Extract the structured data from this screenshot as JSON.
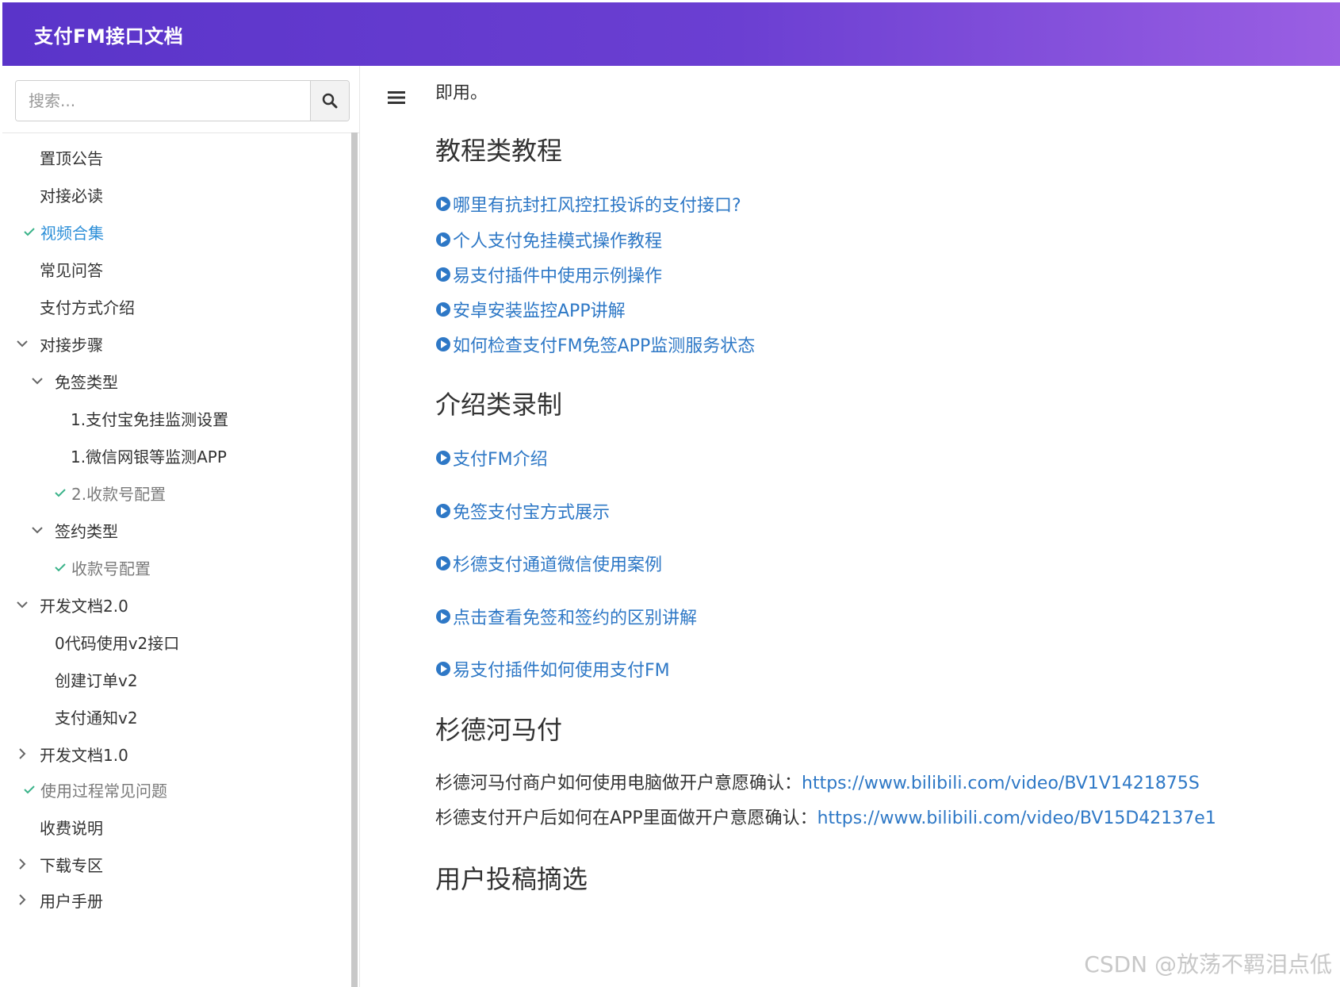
{
  "header": {
    "title": "支付FM接口文档"
  },
  "search": {
    "placeholder": "搜索..."
  },
  "sidebar": {
    "items": [
      {
        "label": "置顶公告"
      },
      {
        "label": "对接必读"
      },
      {
        "label": "视频合集"
      },
      {
        "label": "常见问答"
      },
      {
        "label": "支付方式介绍"
      },
      {
        "label": "对接步骤"
      },
      {
        "label": "免签类型"
      },
      {
        "label": "1.支付宝免挂监测设置"
      },
      {
        "label": "1.微信网银等监测APP"
      },
      {
        "label": "2.收款号配置"
      },
      {
        "label": "签约类型"
      },
      {
        "label": "收款号配置"
      },
      {
        "label": "开发文档2.0"
      },
      {
        "label": "0代码使用v2接口"
      },
      {
        "label": "创建订单v2"
      },
      {
        "label": "支付通知v2"
      },
      {
        "label": "开发文档1.0"
      },
      {
        "label": "使用过程常见问题"
      },
      {
        "label": "收费说明"
      },
      {
        "label": "下载专区"
      },
      {
        "label": "用户手册"
      }
    ]
  },
  "content": {
    "intro_text": "即用。",
    "sections": [
      {
        "heading": "教程类教程",
        "links": [
          "哪里有抗封扛风控扛投诉的支付接口?",
          "个人支付免挂模式操作教程",
          "易支付插件中使用示例操作",
          "安卓安装监控APP讲解",
          "如何检查支付FM免签APP监测服务状态"
        ]
      },
      {
        "heading": "介绍类录制",
        "links": [
          "支付FM介绍",
          "免签支付宝方式展示",
          "杉德支付通道微信使用案例",
          "点击查看免签和签约的区别讲解",
          "易支付插件如何使用支付FM"
        ]
      },
      {
        "heading": "杉德河马付",
        "lines": [
          {
            "text": "杉德河马付商户如何使用电脑做开户意愿确认：",
            "url": "https://www.bilibili.com/video/BV1V1421875S"
          },
          {
            "text": "杉德支付开户后如何在APP里面做开户意愿确认：",
            "url": "https://www.bilibili.com/video/BV15D42137e1"
          }
        ]
      },
      {
        "heading": "用户投稿摘选"
      }
    ]
  },
  "watermark": "CSDN @放荡不羁泪点低",
  "colors": {
    "header_start": "#5a34c9",
    "header_end": "#9a5fe3",
    "link": "#2e78c6",
    "active": "#2d8fd8",
    "check": "#3bb38a"
  }
}
